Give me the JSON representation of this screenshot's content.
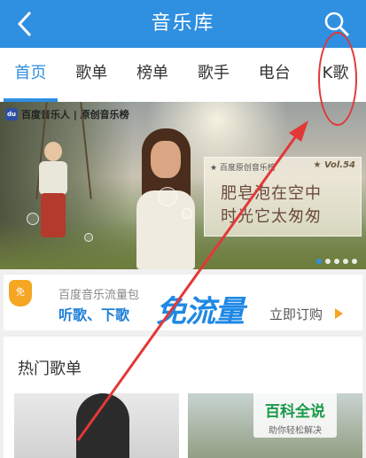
{
  "header": {
    "title": "音乐库",
    "back_icon": "chevron-left-icon",
    "search_icon": "search-icon",
    "bg_color": "#2f8fe0"
  },
  "tabs": [
    {
      "label": "首页",
      "active": true
    },
    {
      "label": "歌单",
      "active": false
    },
    {
      "label": "榜单",
      "active": false
    },
    {
      "label": "歌手",
      "active": false
    },
    {
      "label": "电台",
      "active": false
    },
    {
      "label": "K歌",
      "active": false
    }
  ],
  "banner": {
    "brand": "百度音乐人 | 原创音乐榜",
    "sign_sub": "★ 百度原创音乐榜",
    "sign_vol": "★ Vol.54",
    "line1": "肥皂泡在空中",
    "line2": "时光它太匆匆",
    "dots_total": 5,
    "dots_active": 1
  },
  "promo": {
    "icon_label": "免",
    "sub": "百度音乐流量包",
    "main": "听歌、下歌",
    "big": "免流量",
    "cta": "立即订购"
  },
  "hot": {
    "title": "热门歌单"
  },
  "watermark": {
    "main": "百科全说",
    "sub": "助你轻松解决"
  },
  "annotation_color": "#e23838"
}
